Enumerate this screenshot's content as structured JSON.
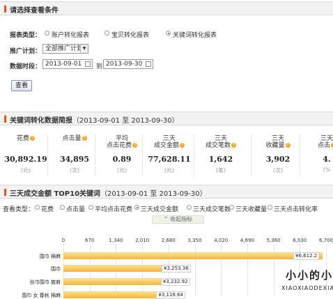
{
  "filter": {
    "header": "请选择查看条件",
    "report_type_label": "报表类型：",
    "report_types": [
      "账户转化报表",
      "宝贝转化报表",
      "关键词转化报表"
    ],
    "report_type_selected": "关键词转化报表",
    "plan_label": "推广计划：",
    "plan_value": "全部推广计划",
    "period_label": "数据时段：",
    "date_start": "2013-09-01",
    "date_sep": "到",
    "date_end": "2013-09-30",
    "query_button": "查看"
  },
  "summary": {
    "header": "关键词转化数据简报",
    "range": "（2013-09-01 至 2013-09-30）",
    "stats": [
      {
        "line1": "",
        "line2": "花费",
        "value": "30,892.19",
        "unit": "(元)"
      },
      {
        "line1": "",
        "line2": "点击量",
        "value": "34,895",
        "unit": "(次)"
      },
      {
        "line1": "平均",
        "line2": "点击花费",
        "value": "0.89",
        "unit": "(元)"
      },
      {
        "line1": "三天",
        "line2": "成交金额",
        "value": "77,628.11",
        "unit": "(元)"
      },
      {
        "line1": "三天",
        "line2": "成交笔数",
        "value": "1,642",
        "unit": "(笔)"
      },
      {
        "line1": "三天",
        "line2": "收藏量",
        "value": "3,902",
        "unit": "(次)"
      },
      {
        "line1": "三天",
        "line2": "点击",
        "value": "4.",
        "unit": "(%"
      }
    ]
  },
  "top10": {
    "header": "三天成交金额 TOP10关键词",
    "range": "（2013-09-01 至 2013-09-30）",
    "view_type_label": "查看类型：",
    "view_types": [
      "花费",
      "点击量",
      "平均点击花费",
      "三天成交金额",
      "三天成交笔数",
      "三天收藏量",
      "三天点击转化率"
    ],
    "view_type_selected": "三天成交金额",
    "collapse_label": "收起指标"
  },
  "chart_data": {
    "type": "bar",
    "orientation": "horizontal",
    "x_ticks": [
      "0",
      "670",
      "1,340",
      "2,010",
      "2,680",
      "3,350",
      "4,020",
      "4,690",
      "5,360",
      "6,030",
      "6,700"
    ],
    "xlim": [
      0,
      6700
    ],
    "categories": [
      "围巾 棉麻",
      "围巾",
      "丝巾围巾 披肩",
      "围巾 女 春秋 棉麻"
    ],
    "values": [
      6612.2,
      3253.36,
      3232.92,
      3116.64
    ],
    "value_labels": [
      "¥6,612.2",
      "¥3,253.36",
      "¥3,232.92",
      "¥3,116.64"
    ],
    "bar_color": "#f4b43c",
    "grid": true
  },
  "watermark": {
    "cn": "小小的小",
    "en": "XIAOXIAODEXIA"
  }
}
